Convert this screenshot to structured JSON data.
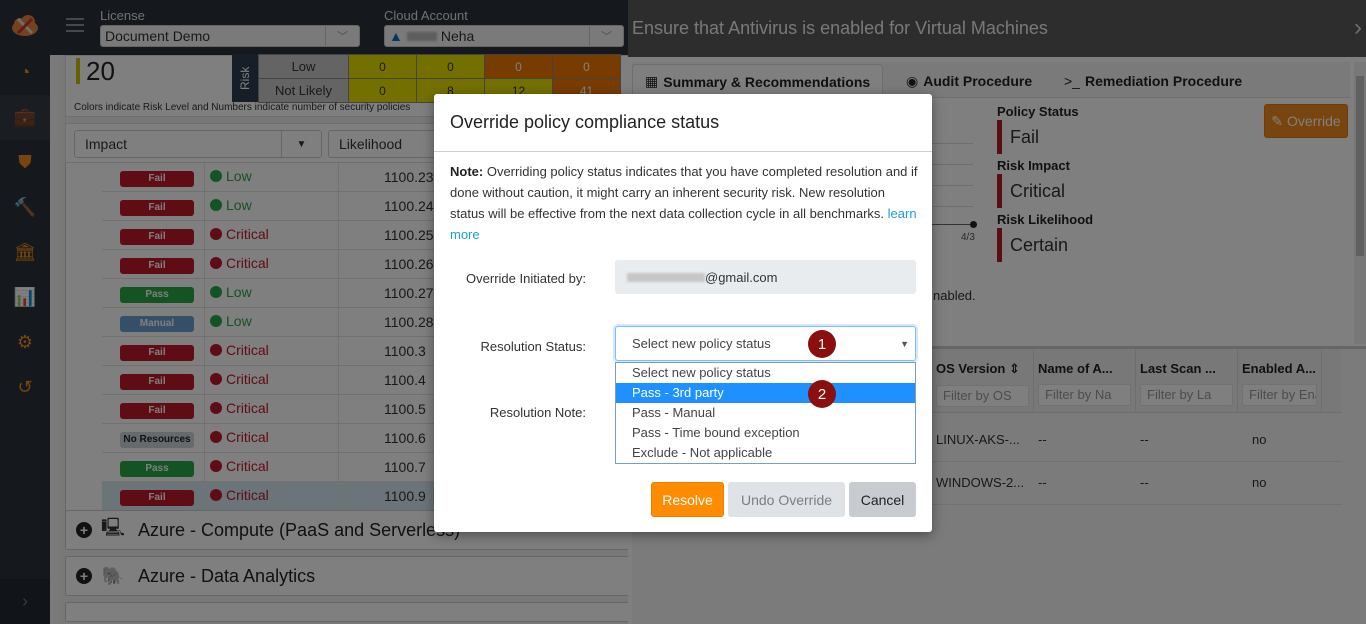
{
  "nav": {
    "items": [
      {
        "name": "dashboard",
        "icon": "◔"
      },
      {
        "name": "briefcase",
        "icon": "💼"
      },
      {
        "name": "shield",
        "icon": "⛊"
      },
      {
        "name": "gavel",
        "icon": "🔨"
      },
      {
        "name": "bank",
        "icon": "🏛"
      },
      {
        "name": "reports",
        "icon": "📊"
      },
      {
        "name": "settings",
        "icon": "⚙"
      },
      {
        "name": "history",
        "icon": "↺"
      }
    ],
    "expand_icon": "›"
  },
  "header": {
    "license_label": "License",
    "license_value": "Document Demo",
    "cloud_label": "Cloud Account",
    "cloud_value": "Neha"
  },
  "summary": {
    "count": "20",
    "risk_label": "Risk",
    "matrix": [
      {
        "label": "Low",
        "cells": [
          {
            "v": "0",
            "c": "yel"
          },
          {
            "v": "0",
            "c": "yel"
          },
          {
            "v": "0",
            "c": "org"
          },
          {
            "v": "0",
            "c": "org"
          }
        ]
      },
      {
        "label": "Not Likely",
        "cells": [
          {
            "v": "0",
            "c": "yel"
          },
          {
            "v": "8",
            "c": "yel"
          },
          {
            "v": "12",
            "c": "yel"
          },
          {
            "v": "41",
            "c": "org"
          }
        ]
      }
    ],
    "note": "Colors indicate Risk Level and Numbers indicate number of security policies"
  },
  "filters": {
    "impact": "Impact",
    "likelihood": "Likelihood"
  },
  "policies": [
    {
      "status": "Fail",
      "impact": "Low",
      "id": "1100.23"
    },
    {
      "status": "Fail",
      "impact": "Low",
      "id": "1100.24"
    },
    {
      "status": "Fail",
      "impact": "Critical",
      "id": "1100.25"
    },
    {
      "status": "Fail",
      "impact": "Critical",
      "id": "1100.26"
    },
    {
      "status": "Pass",
      "impact": "Low",
      "id": "1100.27"
    },
    {
      "status": "Manual",
      "impact": "Low",
      "id": "1100.28"
    },
    {
      "status": "Fail",
      "impact": "Critical",
      "id": "1100.3"
    },
    {
      "status": "Fail",
      "impact": "Critical",
      "id": "1100.4"
    },
    {
      "status": "Fail",
      "impact": "Critical",
      "id": "1100.5"
    },
    {
      "status": "No Resources",
      "impact": "Critical",
      "id": "1100.6"
    },
    {
      "status": "Pass",
      "impact": "Critical",
      "id": "1100.7"
    },
    {
      "status": "Fail",
      "impact": "Critical",
      "id": "1100.9"
    }
  ],
  "sections": [
    {
      "title": "Azure - Compute (PaaS and Serverless)"
    },
    {
      "title": "Azure - Data Analytics"
    }
  ],
  "detail": {
    "title": "Ensure that Antivirus is enabled for Virtual Machines",
    "tabs": [
      {
        "label": "Summary & Recommendations",
        "icon": "▦"
      },
      {
        "label": "Audit Procedure",
        "icon": "◉"
      },
      {
        "label": "Remediation Procedure",
        "icon": ">_"
      }
    ],
    "policy_status_label": "Policy Status",
    "policy_status": "Fail",
    "risk_impact_label": "Risk Impact",
    "risk_impact": "Critical",
    "risk_likelihood_label": "Risk Likelihood",
    "risk_likelihood": "Certain",
    "override_label": "Override",
    "chart_tick": "4/3",
    "enabled_text": "nabled.",
    "table": {
      "columns": [
        {
          "header": "OS Version ⇕",
          "filter": "Filter by OS"
        },
        {
          "header": "Name of A...",
          "filter": "Filter by Na"
        },
        {
          "header": "Last Scan ...",
          "filter": "Filter by La"
        },
        {
          "header": "Enabled A...",
          "filter": "Filter by Ena"
        }
      ],
      "rows": [
        [
          "LINUX-AKS-...",
          "--",
          "--",
          "no"
        ],
        [
          "WINDOWS-2...",
          "--",
          "--",
          "no"
        ]
      ]
    }
  },
  "modal": {
    "title": "Override policy compliance status",
    "note_bold": "Note:",
    "note_text": " Overriding policy status indicates that you have completed resolution and if done without caution, it might carry an inherent security risk. New resolution status will be effective from the next data collection cycle in all benchmarks. ",
    "learn_more": "learn more",
    "initiated_label": "Override Initiated by:",
    "initiated_value": "@gmail.com",
    "status_label": "Resolution Status:",
    "status_placeholder": "Select new policy status",
    "note_label": "Resolution Note:",
    "options": [
      "Select new policy status",
      "Pass - 3rd party",
      "Pass - Manual",
      "Pass - Time bound exception",
      "Exclude - Not applicable"
    ],
    "highlighted_option": 1,
    "markers": [
      "1",
      "2"
    ],
    "resolve_label": "Resolve",
    "undo_label": "Undo Override",
    "cancel_label": "Cancel"
  }
}
